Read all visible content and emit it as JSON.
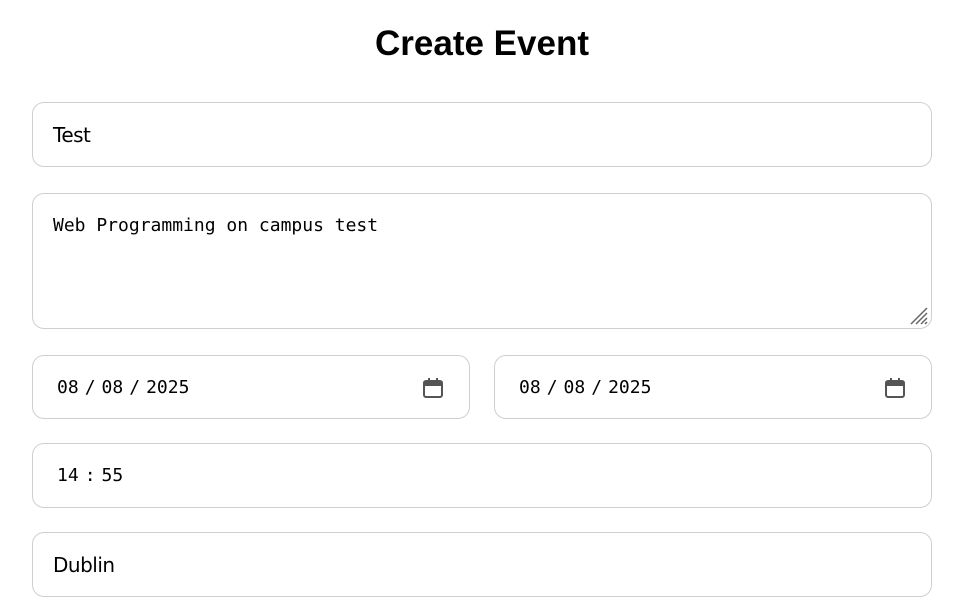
{
  "page": {
    "title": "Create Event"
  },
  "form": {
    "title_value": "Test",
    "description_value": "Web Programming on campus test",
    "start_date": {
      "month": "08",
      "day": "08",
      "year": "2025",
      "separator": "/"
    },
    "end_date": {
      "month": "08",
      "day": "08",
      "year": "2025",
      "separator": "/"
    },
    "time": {
      "hour": "14",
      "minute": "55",
      "separator": ":"
    },
    "location_value": "Dublin"
  },
  "icons": {
    "calendar": "calendar-icon",
    "resize": "resize-handle-icon"
  },
  "colors": {
    "border": "#cfcfcf",
    "text": "#000000",
    "icon": "#555555"
  }
}
